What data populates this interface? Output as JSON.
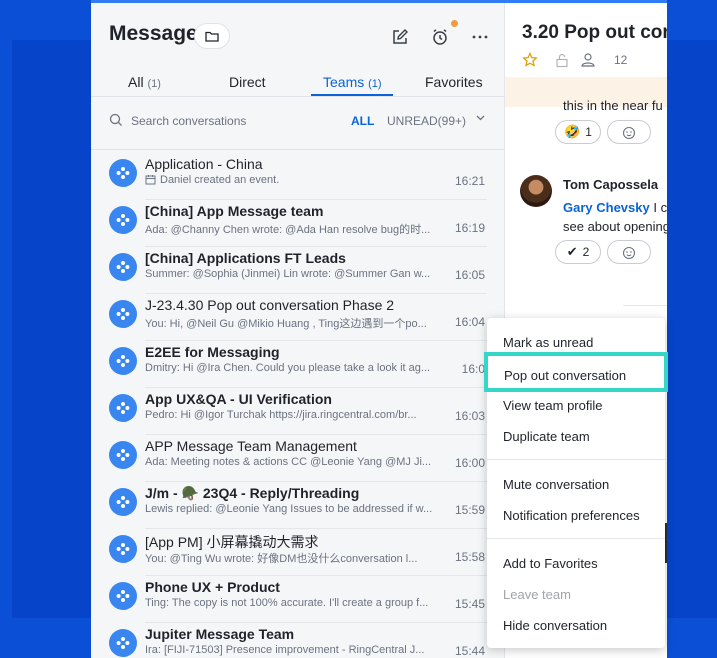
{
  "header": {
    "title": "Message"
  },
  "tabs": [
    {
      "label": "All",
      "count": "(1)"
    },
    {
      "label": "Direct",
      "count": ""
    },
    {
      "label": "Teams",
      "count": "(1)"
    },
    {
      "label": "Favorites",
      "count": ""
    }
  ],
  "search": {
    "placeholder": "Search conversations",
    "filter_all": "ALL",
    "filter_unread": "UNREAD(99+)"
  },
  "conversations": [
    {
      "name": "Application - China",
      "bold": false,
      "preview": "Daniel created an event.",
      "time": "16:21",
      "has_calendar": true
    },
    {
      "name": "[China] App Message team",
      "bold": true,
      "preview": "Ada: @Channy Chen wrote: @Ada Han resolve bug的时...",
      "time": "16:19",
      "has_calendar": false
    },
    {
      "name": "[China] Applications FT Leads",
      "bold": true,
      "preview": "Summer: @Sophia (Jinmei) Lin wrote: @Summer Gan w...",
      "time": "16:05",
      "has_calendar": false
    },
    {
      "name": "J-23.4.30 Pop out conversation Phase 2",
      "bold": false,
      "preview": "You: Hi, @Neil Gu @Mikio Huang , Ting这边遇到一个po...",
      "time": "16:04",
      "has_calendar": false
    },
    {
      "name": "E2EE for Messaging",
      "bold": true,
      "preview": "Dmitry: Hi @Ira Chen. Could you please take a look it ag...",
      "time": "16:0",
      "has_calendar": false
    },
    {
      "name": "App UX&QA - UI Verification",
      "bold": true,
      "preview": "Pedro: Hi @Igor Turchak https://jira.ringcentral.com/br...",
      "time": "16:03",
      "has_calendar": false
    },
    {
      "name": "APP Message Team Management",
      "bold": false,
      "preview": "Ada: Meeting notes & actions CC @Leonie Yang @MJ Ji...",
      "time": "16:00",
      "has_calendar": false
    },
    {
      "name": "J/m - 🪖 23Q4 - Reply/Threading",
      "bold": true,
      "preview": "Lewis replied: @Leonie Yang Issues to be addressed if w...",
      "time": "15:59",
      "has_calendar": false
    },
    {
      "name": "[App PM] 小屏幕撬动大需求",
      "bold": false,
      "preview": "You: @Ting Wu wrote: 好像DM也没什么conversation l...",
      "time": "15:58",
      "has_calendar": false
    },
    {
      "name": "Phone UX + Product",
      "bold": true,
      "preview": "Ting: The copy is not 100% accurate. I'll create a group f...",
      "time": "15:45",
      "has_calendar": false
    },
    {
      "name": "Jupiter Message Team",
      "bold": true,
      "preview": "Ira: [FIJI-71503] Presence improvement - RingCentral J...",
      "time": "15:44",
      "has_calendar": false
    }
  ],
  "conversation": {
    "title": "3.20 Pop out con",
    "member_count": "12",
    "cut_text": "this in the near fu",
    "reaction_1_count": "1",
    "sender": "Tom Capossela",
    "mention": "Gary Chevsky",
    "line1_rest": " I ca",
    "line2": "see about opening",
    "reaction_2_count": "2"
  },
  "context_menu": {
    "items": [
      {
        "label": "Mark as unread",
        "disabled": false
      },
      {
        "label": "Pop out conversation",
        "disabled": false,
        "highlighted": true
      },
      {
        "label": "View team profile",
        "disabled": false
      },
      {
        "label": "Duplicate team",
        "disabled": false
      },
      {
        "label": "Mute conversation",
        "disabled": false
      },
      {
        "label": "Notification preferences",
        "disabled": false
      },
      {
        "label": "Add to Favorites",
        "disabled": false
      },
      {
        "label": "Leave team",
        "disabled": true
      },
      {
        "label": "Hide conversation",
        "disabled": false
      }
    ]
  },
  "colors": {
    "accent": "#0a63d8",
    "highlight_border": "#35d6c8",
    "avatar_blue": "#3a86f0",
    "background": "#0a4fd6"
  },
  "icons": {
    "folder": "folder-icon",
    "compose": "compose-icon",
    "alarm": "alarm-icon",
    "more": "more-icon",
    "search": "search-icon",
    "star": "star-icon",
    "lock": "lock-icon",
    "members": "members-icon"
  }
}
